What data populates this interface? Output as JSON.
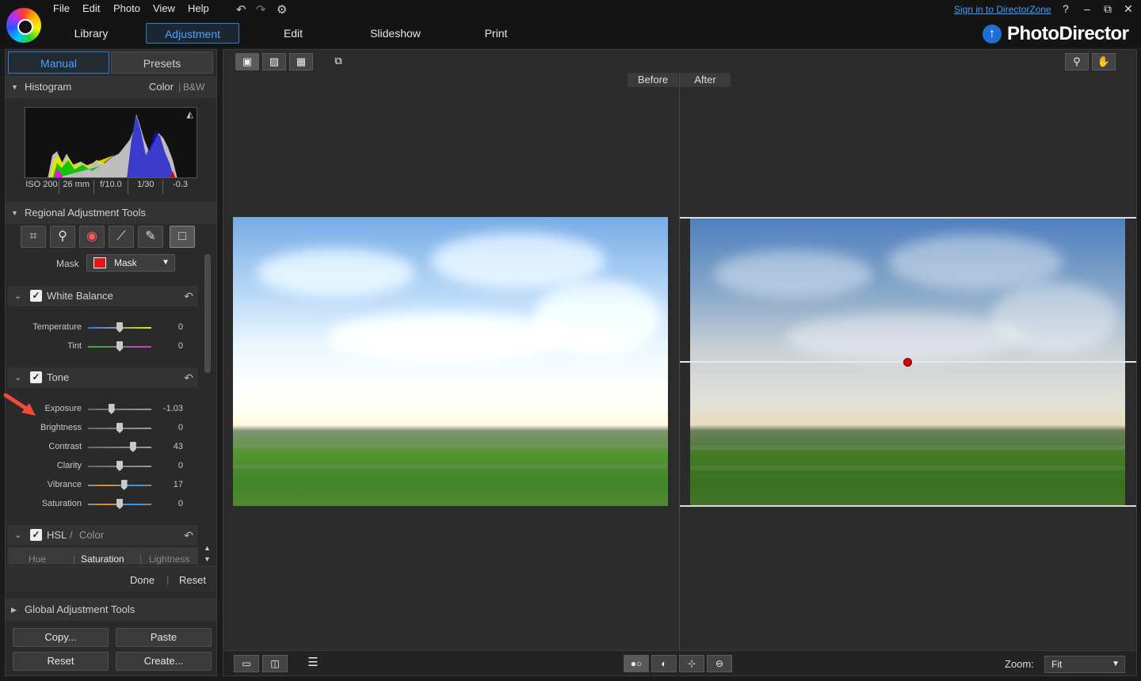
{
  "menu": [
    "File",
    "Edit",
    "Photo",
    "View",
    "Help"
  ],
  "toolbar_icons": [
    "undo-icon",
    "redo-icon",
    "settings-icon"
  ],
  "account": {
    "signin": "Sign in to DirectorZone"
  },
  "window_controls": {
    "help": "?",
    "minimize": "–",
    "restore": "⧉",
    "close": "✕"
  },
  "modes": [
    "Library",
    "Adjustment",
    "Edit",
    "Slideshow",
    "Print"
  ],
  "active_mode": "Adjustment",
  "brand": {
    "name": "PhotoDirector"
  },
  "panel_tabs": {
    "manual": "Manual",
    "presets": "Presets"
  },
  "histogram": {
    "title": "Histogram",
    "color": "Color",
    "bw": "B&W",
    "meta": [
      "ISO 200",
      "26 mm",
      "f/10.0",
      "1/30",
      "-0.3"
    ]
  },
  "regional": {
    "title": "Regional Adjustment Tools",
    "tools": [
      "crop-icon",
      "brush-tool-icon",
      "red-eye-icon",
      "adjustment-brush-icon",
      "radial-filter-icon",
      "graduated-filter-icon"
    ],
    "mask_label": "Mask",
    "mask_value": "Mask",
    "mask_color": "#e01818"
  },
  "white_balance": {
    "title": "White Balance",
    "sliders": [
      {
        "label": "Temperature",
        "value": "0",
        "pos": 0.5
      },
      {
        "label": "Tint",
        "value": "0",
        "pos": 0.5
      }
    ]
  },
  "tone": {
    "title": "Tone",
    "sliders": [
      {
        "label": "Exposure",
        "value": "-1.03",
        "pos": 0.37
      },
      {
        "label": "Brightness",
        "value": "0",
        "pos": 0.5
      },
      {
        "label": "Contrast",
        "value": "43",
        "pos": 0.71
      },
      {
        "label": "Clarity",
        "value": "0",
        "pos": 0.5
      },
      {
        "label": "Vibrance",
        "value": "17",
        "pos": 0.57
      },
      {
        "label": "Saturation",
        "value": "0",
        "pos": 0.5
      }
    ]
  },
  "hsl": {
    "title": "HSL",
    "color_label": "Color",
    "tabs": [
      "Hue",
      "Saturation",
      "Lightness"
    ]
  },
  "actions": {
    "done": "Done",
    "reset": "Reset"
  },
  "global": {
    "title": "Global Adjustment Tools"
  },
  "buttons": {
    "copy": "Copy...",
    "paste": "Paste",
    "reset": "Reset",
    "create": "Create..."
  },
  "compare": {
    "before": "Before",
    "after": "After"
  },
  "zoom": {
    "label": "Zoom:",
    "value": "Fit"
  }
}
